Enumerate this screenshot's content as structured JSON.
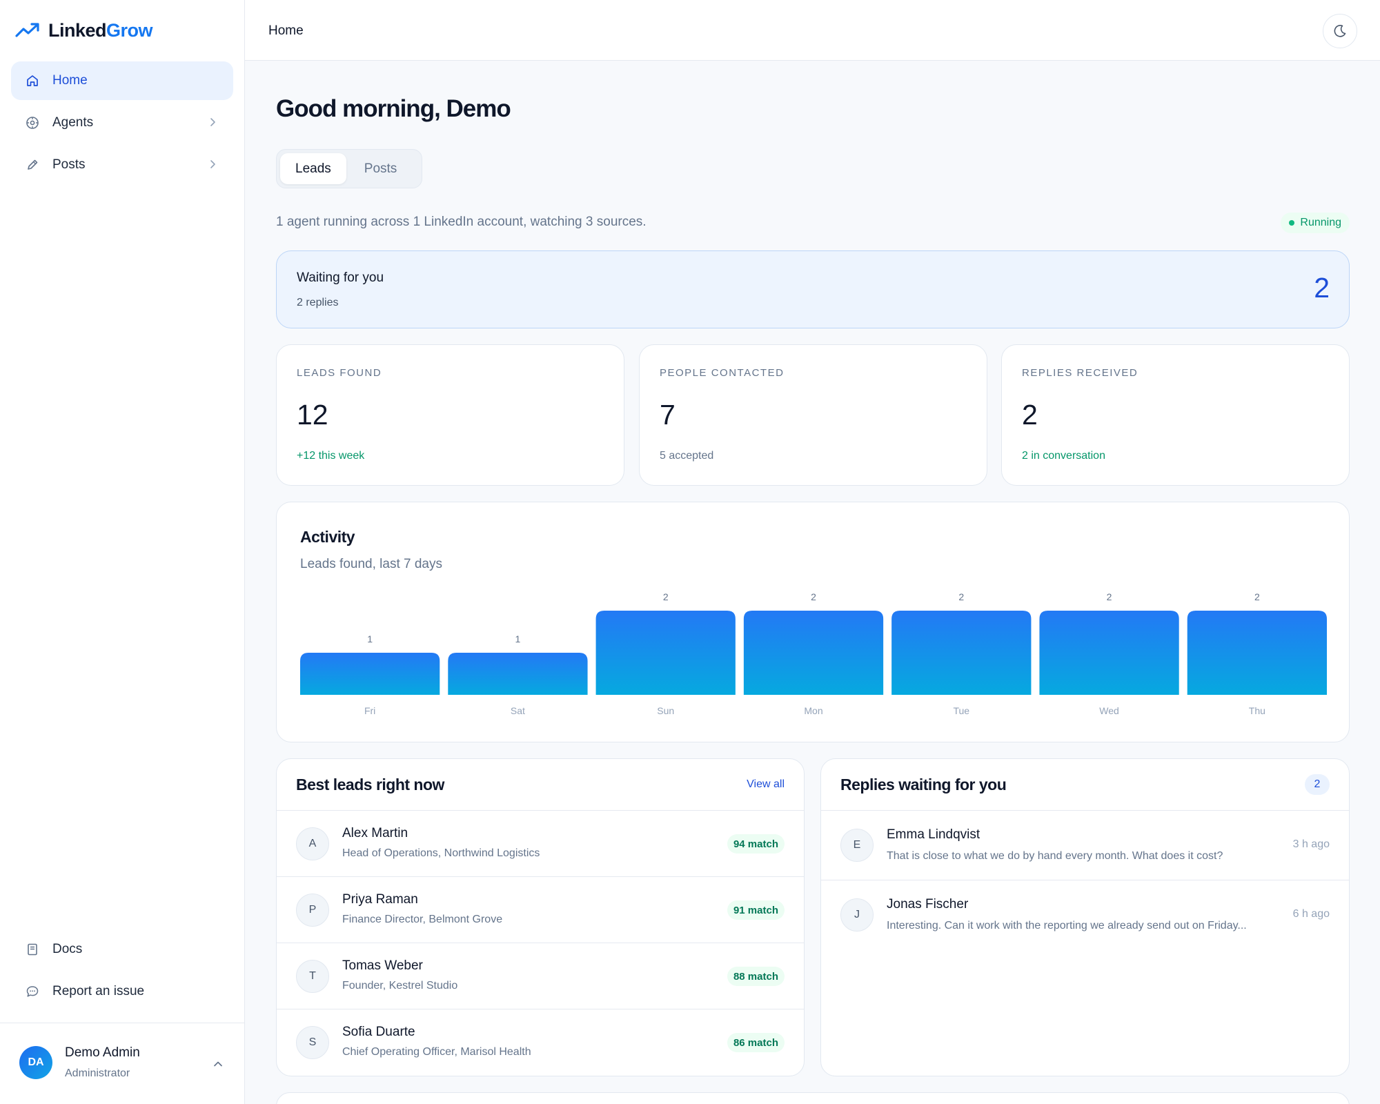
{
  "app": {
    "logo_part1": "Linked",
    "logo_part2": "Grow",
    "brand_color": "#1577f0"
  },
  "sidebar": {
    "items": [
      {
        "label": "Home",
        "icon": "home-icon",
        "active": true
      },
      {
        "label": "Agents",
        "icon": "agents-icon",
        "has_children": true
      },
      {
        "label": "Posts",
        "icon": "pencil-icon",
        "has_children": true
      }
    ],
    "bottom_items": [
      {
        "label": "Docs",
        "icon": "book-icon"
      },
      {
        "label": "Report an issue",
        "icon": "chat-bubble-icon"
      }
    ],
    "user": {
      "initials": "DA",
      "name": "Demo Admin",
      "role": "Administrator"
    }
  },
  "header": {
    "breadcrumb": "Home",
    "theme_icon": "moon-icon"
  },
  "main": {
    "greeting": "Good morning, Demo",
    "tabs": [
      {
        "label": "Leads",
        "active": true
      },
      {
        "label": "Posts",
        "active": false
      }
    ],
    "summary": "1 agent running across 1 LinkedIn account, watching 3 sources.",
    "status": "Running",
    "waiting": {
      "title": "Waiting for you",
      "subtitle": "2 replies",
      "count": "2"
    },
    "stats": [
      {
        "label": "LEADS FOUND",
        "value": "12",
        "sub": "+12 this week",
        "sub_color": "green"
      },
      {
        "label": "PEOPLE CONTACTED",
        "value": "7",
        "sub": "5 accepted",
        "sub_color": "grey"
      },
      {
        "label": "REPLIES RECEIVED",
        "value": "2",
        "sub": "2 in conversation",
        "sub_color": "green"
      }
    ],
    "activity": {
      "title": "Activity",
      "subtitle": "Leads found, last 7 days"
    },
    "best_leads": {
      "title": "Best leads right now",
      "link": "View all",
      "rows": [
        {
          "initial": "A",
          "name": "Alex Martin",
          "title": "Head of Operations, Northwind Logistics",
          "match": "94 match"
        },
        {
          "initial": "P",
          "name": "Priya Raman",
          "title": "Finance Director, Belmont Grove",
          "match": "91 match"
        },
        {
          "initial": "T",
          "name": "Tomas Weber",
          "title": "Founder, Kestrel Studio",
          "match": "88 match"
        },
        {
          "initial": "S",
          "name": "Sofia Duarte",
          "title": "Chief Operating Officer, Marisol Health",
          "match": "86 match"
        }
      ]
    },
    "replies": {
      "title": "Replies waiting for you",
      "count": "2",
      "rows": [
        {
          "initial": "E",
          "name": "Emma Lindqvist",
          "text": "That is close to what we do by hand every month. What does it cost?",
          "time": "3 h ago"
        },
        {
          "initial": "J",
          "name": "Jonas Fischer",
          "text": "Interesting. Can it work with the reporting we already send out on Friday...",
          "time": "6 h ago"
        }
      ]
    }
  },
  "chart_data": {
    "type": "bar",
    "categories": [
      "Fri",
      "Sat",
      "Sun",
      "Mon",
      "Tue",
      "Wed",
      "Thu"
    ],
    "values": [
      1,
      1,
      2,
      2,
      2,
      2,
      2
    ],
    "ylim": [
      0,
      2
    ],
    "grid": false,
    "colors": {
      "top": "#2379f5",
      "bottom": "#06a9df"
    }
  }
}
